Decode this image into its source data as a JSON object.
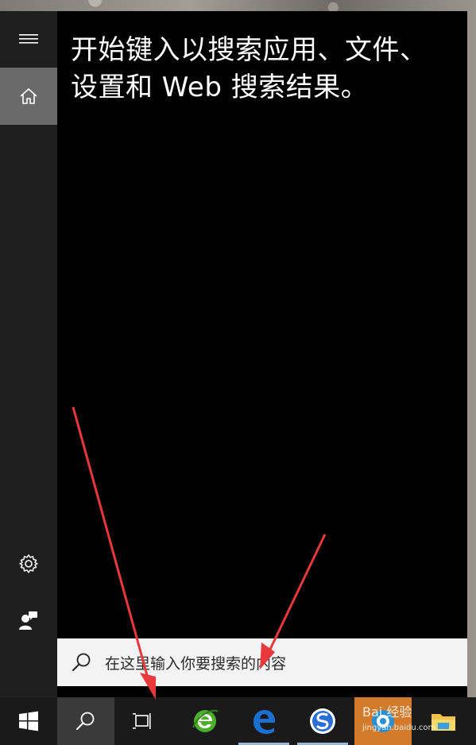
{
  "start_menu": {
    "prompt_line1": "开始键入以搜索应用、文件、",
    "prompt_line2": "设置和 Web 搜索结果。",
    "rail_icons": [
      "hamburger-menu-icon",
      "home-icon",
      "gear-icon",
      "user-icon"
    ]
  },
  "searchbox": {
    "placeholder": "在这里输入你要搜索的内容"
  },
  "taskbar": {
    "items": [
      "windows-start-icon",
      "search-icon",
      "task-view-icon",
      "ie-browser-icon",
      "edge-icon",
      "sogou-browser-icon",
      "app-icon",
      "file-explorer-icon"
    ]
  },
  "watermark": {
    "text": "Bai 经验",
    "subtext": "jingyan.baidu.com"
  },
  "colors": {
    "accent": "#d37b2a",
    "arrow": "#e8383b",
    "edge_blue": "#1b6fd1",
    "ie_green": "#4caf2a"
  }
}
